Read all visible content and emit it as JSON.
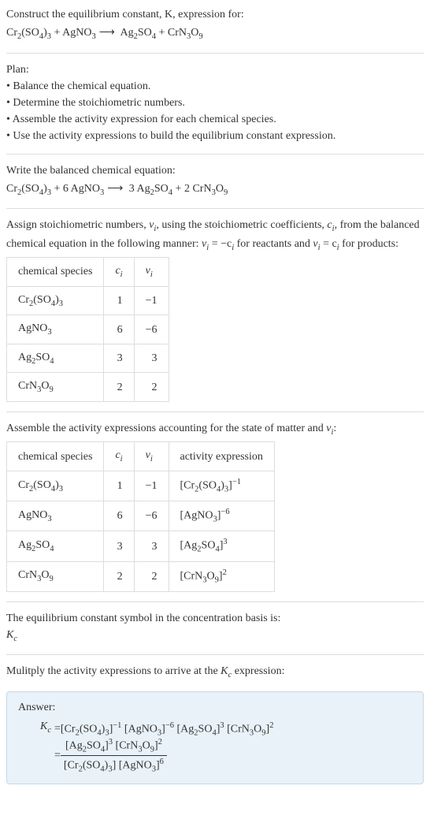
{
  "intro": {
    "line1": "Construct the equilibrium constant, K, expression for:",
    "equation_lhs1": "Cr",
    "equation_lhs1_sub1": "2",
    "equation_lhs1_mid": "(SO",
    "equation_lhs1_sub2": "4",
    "equation_lhs1_end": ")",
    "equation_lhs1_sub3": "3",
    "plus1": " + AgNO",
    "agno3_sub": "3",
    "arrow": " ⟶ ",
    "rhs1": " Ag",
    "ag2_sub": "2",
    "rhs1_mid": "SO",
    "so4_sub": "4",
    "plus2": " + CrN",
    "crn_sub1": "3",
    "crn_mid": "O",
    "crn_sub2": "9"
  },
  "plan": {
    "header": "Plan:",
    "items": [
      "• Balance the chemical equation.",
      "• Determine the stoichiometric numbers.",
      "• Assemble the activity expression for each chemical species.",
      "• Use the activity expressions to build the equilibrium constant expression."
    ]
  },
  "balanced": {
    "header": "Write the balanced chemical equation:",
    "coef2": "6",
    "coef3": "3",
    "coef4": "2"
  },
  "stoich": {
    "text1": "Assign stoichiometric numbers, ",
    "var1": "ν",
    "sub1": "i",
    "text2": ", using the stoichiometric coefficients, ",
    "var2": "c",
    "sub2": "i",
    "text3": ", from the balanced chemical equation in the following manner: ",
    "eq1": "ν",
    "eq1sub": "i",
    "eq1mid": " = −c",
    "eq1sub2": "i",
    "text4": " for reactants and ",
    "eq2": "ν",
    "eq2sub": "i",
    "eq2mid": " = c",
    "eq2sub2": "i",
    "text5": " for products:"
  },
  "table1": {
    "headers": [
      "chemical species",
      "cᵢ",
      "νᵢ"
    ],
    "h1": "chemical species",
    "h2_var": "c",
    "h2_sub": "i",
    "h3_var": "ν",
    "h3_sub": "i",
    "rows": [
      {
        "species": "Cr₂(SO₄)₃",
        "c": "1",
        "v": "−1"
      },
      {
        "species": "AgNO₃",
        "c": "6",
        "v": "−6"
      },
      {
        "species": "Ag₂SO₄",
        "c": "3",
        "v": "3"
      },
      {
        "species": "CrN₃O₉",
        "c": "2",
        "v": "2"
      }
    ]
  },
  "assemble": {
    "text1": "Assemble the activity expressions accounting for the state of matter and ",
    "var": "ν",
    "sub": "i",
    "text2": ":"
  },
  "table2": {
    "h1": "chemical species",
    "h2_var": "c",
    "h2_sub": "i",
    "h3_var": "ν",
    "h3_sub": "i",
    "h4": "activity expression",
    "rows": [
      {
        "c": "1",
        "v": "−1",
        "exp": "−1"
      },
      {
        "c": "6",
        "v": "−6",
        "exp": "−6"
      },
      {
        "c": "3",
        "v": "3",
        "exp": "3"
      },
      {
        "c": "2",
        "v": "2",
        "exp": "2"
      }
    ]
  },
  "symbol": {
    "text": "The equilibrium constant symbol in the concentration basis is:",
    "kc_k": "K",
    "kc_sub": "c"
  },
  "multiply": {
    "text1": "Mulitply the activity expressions to arrive at the ",
    "k": "K",
    "ksub": "c",
    "text2": " expression:"
  },
  "answer": {
    "label": "Answer:",
    "k": "K",
    "ksub": "c",
    "eq": " = ",
    "exp1": "−1",
    "exp2": "−6",
    "exp3": "3",
    "exp4": "2",
    "exp5": "3",
    "exp6": "2",
    "exp7": "6"
  }
}
